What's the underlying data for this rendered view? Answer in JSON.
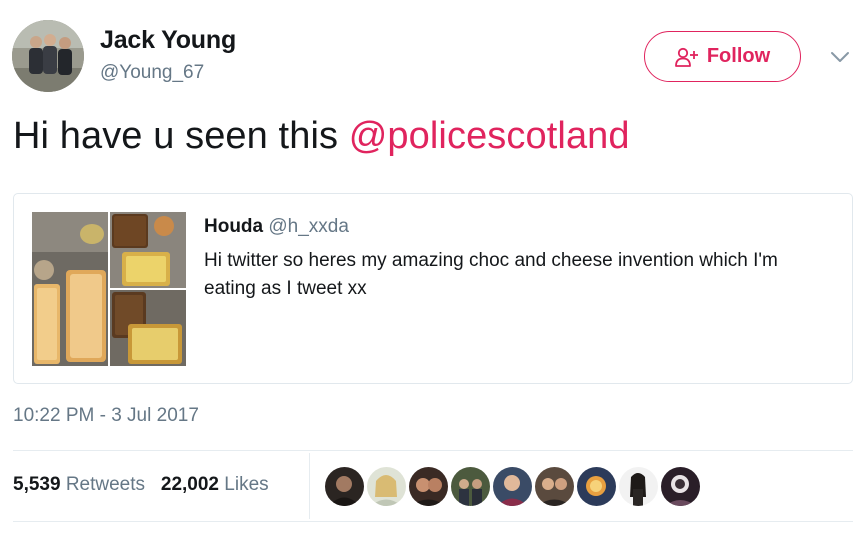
{
  "tweet": {
    "author_name": "Jack Young",
    "author_handle": "@Young_67",
    "text_prefix": "Hi have u seen this ",
    "mention": "@policescotland",
    "timestamp": "10:22 PM - 3 Jul 2017"
  },
  "follow_button": {
    "label": "Follow",
    "color": "#e0245e"
  },
  "quoted_tweet": {
    "author_name": "Houda",
    "author_handle": "@h_xxda",
    "text": "Hi twitter so heres my amazing choc and cheese invention which I'm eating as I tweet xx"
  },
  "stats": {
    "retweets_count": "5,539",
    "retweets_label": "Retweets",
    "likes_count": "22,002",
    "likes_label": "Likes"
  },
  "colors": {
    "mention": "#e0245e",
    "secondary_text": "#657786",
    "border": "#e1e8ed"
  }
}
